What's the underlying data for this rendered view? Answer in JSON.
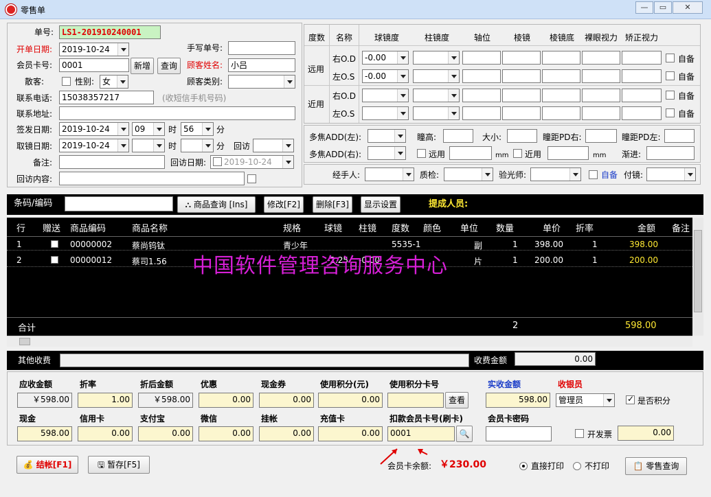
{
  "window": {
    "title": "零售单",
    "btn_min": "—",
    "btn_max": "▭",
    "btn_close": "✕"
  },
  "form": {
    "order_no_label": "单号:",
    "order_no": "LS1-201910240001",
    "open_date_label": "开单日期:",
    "open_date": "2019-10-24",
    "manual_no_label": "手写单号:",
    "manual_no": "",
    "card_no_label": "会员卡号:",
    "card_no": "0001",
    "add_label": "新增",
    "query_label": "查询",
    "customer_name_label": "顾客姓名:",
    "customer_name": "小吕",
    "walkin_label": "散客:",
    "gender_label": "性别:",
    "gender": "女",
    "customer_type_label": "顾客类别:",
    "customer_type": "",
    "phone_label": "联系电话:",
    "phone": "15038357217",
    "phone_hint": "(收短信手机号码)",
    "address_label": "联系地址:",
    "address": "",
    "issue_date_label": "签发日期:",
    "issue_date": "2019-10-24",
    "issue_hour": "09",
    "hour_unit": "时",
    "issue_min": "56",
    "min_unit": "分",
    "pickup_date_label": "取镜日期:",
    "pickup_date": "2019-10-24",
    "pickup_hour": "",
    "pickup_min": "",
    "revisit_label": "回访",
    "revisit": "",
    "remark_label": "备注:",
    "remark": "",
    "revisit_date_label": "回访日期:",
    "revisit_date": "2019-10-24",
    "revisit_content_label": "回访内容:",
    "revisit_content": ""
  },
  "rx": {
    "headers": [
      "度数",
      "名称",
      "球镜度",
      "柱镜度",
      "轴位",
      "棱镜",
      "棱镜底",
      "裸眼视力",
      "矫正视力"
    ],
    "far_label": "远用",
    "near_label": "近用",
    "self_label": "自备",
    "rows": [
      {
        "name": "右O.D",
        "sph": "-0.00"
      },
      {
        "name": "左O.S",
        "sph": "-0.00"
      },
      {
        "name": "右O.D",
        "sph": ""
      },
      {
        "name": "左O.S",
        "sph": ""
      }
    ],
    "add_left_label": "多焦ADD(左):",
    "pupil_height_label": "瞳高:",
    "size_label": "大小:",
    "pd_right_label": "瞳距PD右:",
    "pd_left_label": "瞳距PD左:",
    "add_right_label": "多焦ADD(右):",
    "far_use_label": "远用",
    "near_use_label": "近用",
    "mm_label": "mm",
    "progressive_label": "渐进:",
    "handler_label": "经手人:",
    "qc_label": "质检:",
    "optometrist_label": "验光师:",
    "self_bring_label": "自备",
    "lens_label": "付镜:"
  },
  "toolbar": {
    "barcode_label": "条码/编码",
    "product_query": "商品查询 [Ins]",
    "modify": "修改[F2]",
    "delete": "删除[F3]",
    "display_settings": "显示设置",
    "commission_label": "提成人员:"
  },
  "grid": {
    "headers": [
      "行",
      "赠送",
      "商品编码",
      "商品名称",
      "规格",
      "球镜",
      "柱镜",
      "度数",
      "颜色",
      "单位",
      "数量",
      "单价",
      "折率",
      "金额",
      "备注"
    ],
    "rows": [
      {
        "line": "1",
        "code": "00000002",
        "name": "蔡尚钨钛",
        "spec": "青少年",
        "sph": "",
        "cyl": "",
        "degree": "5535-1",
        "color": "",
        "unit": "副",
        "qty": "1",
        "price": "398.00",
        "rate": "1",
        "amount": "398.00"
      },
      {
        "line": "2",
        "code": "00000012",
        "name": "蔡司1.56",
        "spec": "",
        "sph": "-2.25",
        "cyl": "-0.00",
        "degree": "",
        "color": "",
        "unit": "片",
        "qty": "1",
        "price": "200.00",
        "rate": "1",
        "amount": "200.00"
      }
    ],
    "total_label": "合计",
    "total_qty": "2",
    "total_amount": "598.00",
    "watermark": "中国软件管理咨询服务中心"
  },
  "other": {
    "other_fee_label": "其他收费",
    "fee_amount_label": "收费金额",
    "fee_amount": "0.00"
  },
  "payment": {
    "receivable_label": "应收金额",
    "receivable": "￥598.00",
    "discount_label": "折率",
    "discount": "1.00",
    "after_discount_label": "折后金额",
    "after_discount": "￥598.00",
    "promo_label": "优惠",
    "promo": "0.00",
    "coupon_label": "现金券",
    "coupon": "0.00",
    "points_label": "使用积分(元)",
    "points": "0.00",
    "points_card_label": "使用积分卡号",
    "points_card": "",
    "check_label": "查看",
    "actual_label": "实收金额",
    "actual": "598.00",
    "cashier_label": "收银员",
    "cashier": "管理员",
    "is_points_label": "是否积分",
    "cash_label": "现金",
    "cash": "598.00",
    "credit_label": "信用卡",
    "credit": "0.00",
    "alipay_label": "支付宝",
    "alipay": "0.00",
    "wechat_label": "微信",
    "wechat": "0.00",
    "account_label": "挂帐",
    "account": "0.00",
    "recharge_label": "充值卡",
    "recharge": "0.00",
    "deduct_card_label": "扣款会员卡号(刷卡)",
    "deduct_card": "0001",
    "card_pwd_label": "会员卡密码",
    "card_pwd": "",
    "invoice_label": "开发票",
    "invoice": "0.00"
  },
  "footer": {
    "checkout": "结帐[F1]",
    "hold": "暂存[F5]",
    "balance_label": "会员卡余额:",
    "balance": "￥230.00",
    "print_direct": "直接打印",
    "no_print": "不打印",
    "retail_query": "零售查询"
  },
  "colors": {
    "accent_red": "#e00000",
    "accent_blue": "#1a3cc8",
    "grid_bg": "#000000",
    "amount_yellow": "#ffe933",
    "watermark": "#d61fd6",
    "field_yellow": "#fcf6cf",
    "field_green": "#c9f3c2"
  }
}
